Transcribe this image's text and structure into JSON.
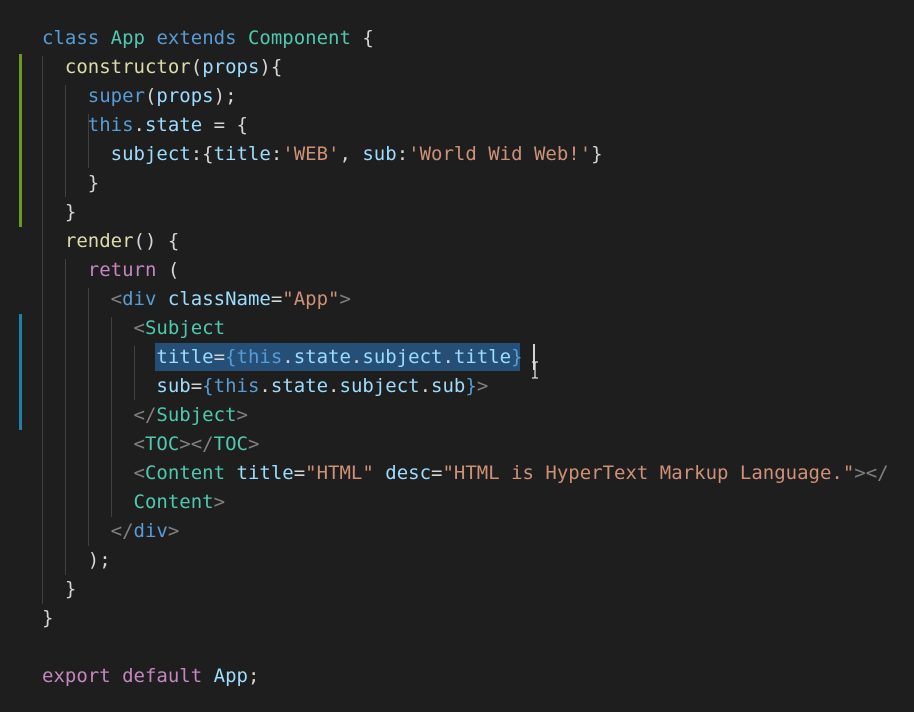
{
  "editor": {
    "colors": {
      "background": "#1e1e1e",
      "keyword": "#c586c0",
      "storage": "#569cd6",
      "class_name": "#4ec9b0",
      "function": "#dcdcaa",
      "variable": "#9cdcfe",
      "string": "#ce9178",
      "punctuation": "#d4d4d4",
      "tag_bracket": "#808080",
      "selection": "#264f78",
      "gutter_modified": "#6a9a23",
      "gutter_added": "#1b81a8"
    },
    "lines": [
      [
        [
          "class",
          "storage"
        ],
        [
          " ",
          "punctuation"
        ],
        [
          "App",
          "class_name"
        ],
        [
          " ",
          "punctuation"
        ],
        [
          "extends",
          "storage"
        ],
        [
          " ",
          "punctuation"
        ],
        [
          "Component",
          "class_name"
        ],
        [
          " {",
          "punctuation"
        ]
      ],
      [
        [
          "  ",
          "punctuation"
        ],
        [
          "constructor",
          "function"
        ],
        [
          "(",
          "punctuation"
        ],
        [
          "props",
          "variable"
        ],
        [
          "){",
          "punctuation"
        ]
      ],
      [
        [
          "    ",
          "punctuation"
        ],
        [
          "super",
          "storage"
        ],
        [
          "(",
          "punctuation"
        ],
        [
          "props",
          "variable"
        ],
        [
          ");",
          "punctuation"
        ]
      ],
      [
        [
          "    ",
          "punctuation"
        ],
        [
          "this",
          "storage"
        ],
        [
          ".",
          "punctuation"
        ],
        [
          "state",
          "variable"
        ],
        [
          " = {",
          "punctuation"
        ]
      ],
      [
        [
          "      ",
          "punctuation"
        ],
        [
          "subject",
          "variable"
        ],
        [
          ":{",
          "punctuation"
        ],
        [
          "title",
          "variable"
        ],
        [
          ":",
          "punctuation"
        ],
        [
          "'WEB'",
          "string"
        ],
        [
          ", ",
          "punctuation"
        ],
        [
          "sub",
          "variable"
        ],
        [
          ":",
          "punctuation"
        ],
        [
          "'World Wid Web!'",
          "string"
        ],
        [
          "}",
          "punctuation"
        ]
      ],
      [
        [
          "    }",
          "punctuation"
        ]
      ],
      [
        [
          "  }",
          "punctuation"
        ]
      ],
      [
        [
          "  ",
          "punctuation"
        ],
        [
          "render",
          "function"
        ],
        [
          "() {",
          "punctuation"
        ]
      ],
      [
        [
          "    ",
          "punctuation"
        ],
        [
          "return",
          "keyword"
        ],
        [
          " (",
          "punctuation"
        ]
      ],
      [
        [
          "      ",
          "punctuation"
        ],
        [
          "<",
          "tag_bracket"
        ],
        [
          "div",
          "storage"
        ],
        [
          " ",
          "punctuation"
        ],
        [
          "className",
          "variable"
        ],
        [
          "=",
          "punctuation"
        ],
        [
          "\"App\"",
          "string"
        ],
        [
          ">",
          "tag_bracket"
        ]
      ],
      [
        [
          "        ",
          "punctuation"
        ],
        [
          "<",
          "tag_bracket"
        ],
        [
          "Subject",
          "class_name"
        ]
      ],
      [
        [
          "          ",
          "punctuation"
        ],
        [
          "title",
          "variable"
        ],
        [
          "=",
          "punctuation"
        ],
        [
          "{",
          "storage"
        ],
        [
          "this",
          "storage"
        ],
        [
          ".",
          "punctuation"
        ],
        [
          "state",
          "variable"
        ],
        [
          ".",
          "punctuation"
        ],
        [
          "subject",
          "variable"
        ],
        [
          ".",
          "punctuation"
        ],
        [
          "title",
          "variable"
        ],
        [
          "}",
          "storage"
        ]
      ],
      [
        [
          "          ",
          "punctuation"
        ],
        [
          "sub",
          "variable"
        ],
        [
          "=",
          "punctuation"
        ],
        [
          "{",
          "storage"
        ],
        [
          "this",
          "storage"
        ],
        [
          ".",
          "punctuation"
        ],
        [
          "state",
          "variable"
        ],
        [
          ".",
          "punctuation"
        ],
        [
          "subject",
          "variable"
        ],
        [
          ".",
          "punctuation"
        ],
        [
          "sub",
          "variable"
        ],
        [
          "}",
          "storage"
        ],
        [
          ">",
          "tag_bracket"
        ]
      ],
      [
        [
          "        ",
          "punctuation"
        ],
        [
          "</",
          "tag_bracket"
        ],
        [
          "Subject",
          "class_name"
        ],
        [
          ">",
          "tag_bracket"
        ]
      ],
      [
        [
          "        ",
          "punctuation"
        ],
        [
          "<",
          "tag_bracket"
        ],
        [
          "TOC",
          "class_name"
        ],
        [
          "></",
          "tag_bracket"
        ],
        [
          "TOC",
          "class_name"
        ],
        [
          ">",
          "tag_bracket"
        ]
      ],
      [
        [
          "        ",
          "punctuation"
        ],
        [
          "<",
          "tag_bracket"
        ],
        [
          "Content",
          "class_name"
        ],
        [
          " ",
          "punctuation"
        ],
        [
          "title",
          "variable"
        ],
        [
          "=",
          "punctuation"
        ],
        [
          "\"HTML\"",
          "string"
        ],
        [
          " ",
          "punctuation"
        ],
        [
          "desc",
          "variable"
        ],
        [
          "=",
          "punctuation"
        ],
        [
          "\"HTML is HyperText Markup Language.\"",
          "string"
        ],
        [
          "></",
          "tag_bracket"
        ]
      ],
      [
        [
          "        ",
          "punctuation"
        ],
        [
          "Content",
          "class_name"
        ],
        [
          ">",
          "tag_bracket"
        ]
      ],
      [
        [
          "      ",
          "punctuation"
        ],
        [
          "</",
          "tag_bracket"
        ],
        [
          "div",
          "storage"
        ],
        [
          ">",
          "tag_bracket"
        ]
      ],
      [
        [
          "    );",
          "punctuation"
        ]
      ],
      [
        [
          "  }",
          "punctuation"
        ]
      ],
      [
        [
          "}",
          "punctuation"
        ]
      ],
      [],
      [
        [
          "export",
          "keyword"
        ],
        [
          " ",
          "punctuation"
        ],
        [
          "default",
          "keyword"
        ],
        [
          " ",
          "punctuation"
        ],
        [
          "App",
          "variable"
        ],
        [
          ";",
          "punctuation"
        ]
      ]
    ]
  }
}
